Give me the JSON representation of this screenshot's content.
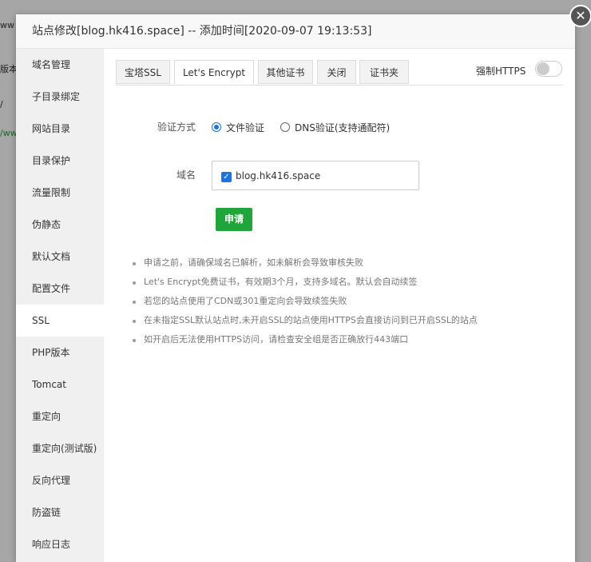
{
  "background": {
    "rows": [
      "ww",
      "版本",
      "/",
      "/ww"
    ]
  },
  "dialog": {
    "title": "站点修改[blog.hk416.space] -- 添加时间[2020-09-07 19:13:53]",
    "close_icon": "close-icon"
  },
  "sidebar": {
    "items": [
      {
        "label": "域名管理"
      },
      {
        "label": "子目录绑定"
      },
      {
        "label": "网站目录"
      },
      {
        "label": "目录保护"
      },
      {
        "label": "流量限制"
      },
      {
        "label": "伪静态"
      },
      {
        "label": "默认文档"
      },
      {
        "label": "配置文件"
      },
      {
        "label": "SSL",
        "active": true
      },
      {
        "label": "PHP版本"
      },
      {
        "label": "Tomcat"
      },
      {
        "label": "重定向"
      },
      {
        "label": "重定向(测试版)"
      },
      {
        "label": "反向代理"
      },
      {
        "label": "防盗链"
      },
      {
        "label": "响应日志"
      }
    ]
  },
  "tabs": [
    {
      "label": "宝塔SSL"
    },
    {
      "label": "Let's Encrypt",
      "active": true
    },
    {
      "label": "其他证书"
    },
    {
      "label": "关闭"
    },
    {
      "label": "证书夹"
    }
  ],
  "force_https": {
    "label": "强制HTTPS",
    "enabled": false
  },
  "verify": {
    "label": "验证方式",
    "options": [
      {
        "label": "文件验证",
        "checked": true
      },
      {
        "label": "DNS验证(支持通配符)",
        "checked": false
      }
    ]
  },
  "domain": {
    "label": "域名",
    "value": "blog.hk416.space",
    "checked": true
  },
  "apply_button": "申请",
  "notes": [
    "申请之前，请确保域名已解析，如未解析会导致审核失败",
    "Let's Encrypt免费证书，有效期3个月，支持多域名。默认会自动续签",
    "若您的站点使用了CDN或301重定向会导致续签失败",
    "在未指定SSL默认站点时,未开启SSL的站点使用HTTPS会直接访问到已开启SSL的站点",
    "如开启后无法使用HTTPS访问，请检查安全组是否正确放行443端口"
  ],
  "colors": {
    "accent": "#20a53a",
    "primary": "#1a73e8"
  }
}
